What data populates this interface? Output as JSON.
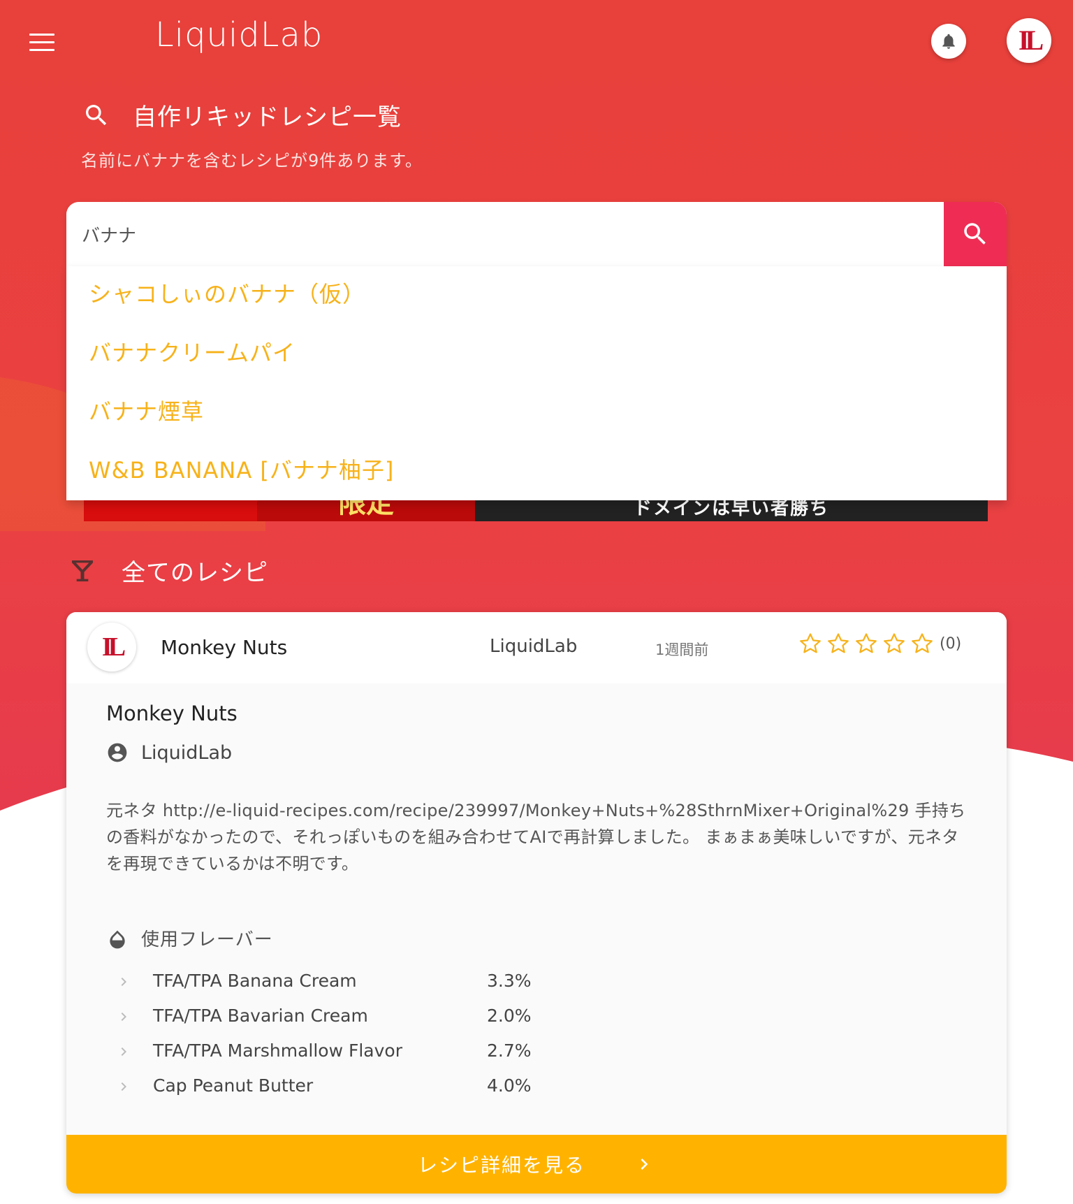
{
  "header": {
    "app_title": "LiquidLab",
    "menu_icon": "hamburger-menu-icon",
    "bell_icon": "bell-icon",
    "avatar_logo": "IL"
  },
  "search_section": {
    "title": "自作リキッドレシピ一覧",
    "subtitle": "名前にバナナを含むレシピが9件あります。",
    "query": "バナナ",
    "suggestions": [
      "シャコしぃのバナナ（仮）",
      "バナナクリームパイ",
      "バナナ煙草",
      "W&B BANANA [バナナ柚子]"
    ]
  },
  "banner": {
    "left_text": "限定",
    "right_text": "ドメインは早い者勝ち"
  },
  "all_recipes": {
    "title": "全てのレシピ",
    "icon": "cocktail-glass-icon"
  },
  "recipe_card": {
    "avatar_logo": "IL",
    "name": "Monkey Nuts",
    "author": "LiquidLab",
    "time": "1週間前",
    "rating_count": "(0)",
    "rating_stars": 0,
    "rating_max": 5,
    "detail_title": "Monkey Nuts",
    "detail_author": "LiquidLab",
    "description": "元ネタ http://e-liquid-recipes.com/recipe/239997/Monkey+Nuts+%28SthrnMixer+Original%29 手持ちの香料がなかったので、それっぽいものを組み合わせてAIで再計算しました。 まぁまぁ美味しいですが、元ネタを再現できているかは不明です。",
    "flavors_label": "使用フレーバー",
    "flavors": [
      {
        "name": "TFA/TPA Banana Cream",
        "pct": "3.3%"
      },
      {
        "name": "TFA/TPA Bavarian Cream",
        "pct": "2.0%"
      },
      {
        "name": "TFA/TPA Marshmallow Flavor",
        "pct": "2.7%"
      },
      {
        "name": "Cap Peanut Butter",
        "pct": "4.0%"
      }
    ],
    "detail_button": "レシピ詳細を見る"
  },
  "colors": {
    "primary_red": "#e8403a",
    "search_button": "#ef2d54",
    "suggestion_text": "#f7b21a",
    "detail_button": "#ffb300",
    "star": "#f7b21a"
  }
}
